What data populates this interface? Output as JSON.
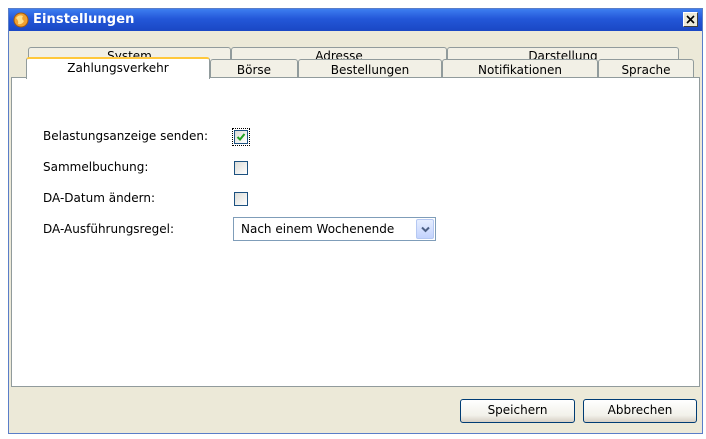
{
  "window": {
    "title": "Einstellungen"
  },
  "tabs": {
    "row_back": [
      {
        "label": "System"
      },
      {
        "label": "Adresse"
      },
      {
        "label": "Darstellung"
      }
    ],
    "row_front": [
      {
        "label": "Zahlungsverkehr",
        "active": true
      },
      {
        "label": "Börse"
      },
      {
        "label": "Bestellungen"
      },
      {
        "label": "Notifikationen"
      },
      {
        "label": "Sprache"
      }
    ]
  },
  "form": {
    "belastung_label": "Belastungsanzeige senden:",
    "belastung_checked": true,
    "sammel_label": "Sammelbuchung:",
    "sammel_checked": false,
    "datum_label": "DA-Datum ändern:",
    "datum_checked": false,
    "regel_label": "DA-Ausführungsregel:",
    "regel_value": "Nach einem Wochenende"
  },
  "buttons": {
    "save_label": "Speichern",
    "cancel_label": "Abbrechen"
  },
  "colors": {
    "titlebar": "#2357d8",
    "window_bg": "#ece9d8",
    "active_tab_accent": "#ffc83c",
    "check_mark": "#21a121"
  },
  "icons": {
    "app": "app-globe-icon",
    "close": "close-icon",
    "dropdown": "chevron-down-icon",
    "check": "check-icon"
  }
}
